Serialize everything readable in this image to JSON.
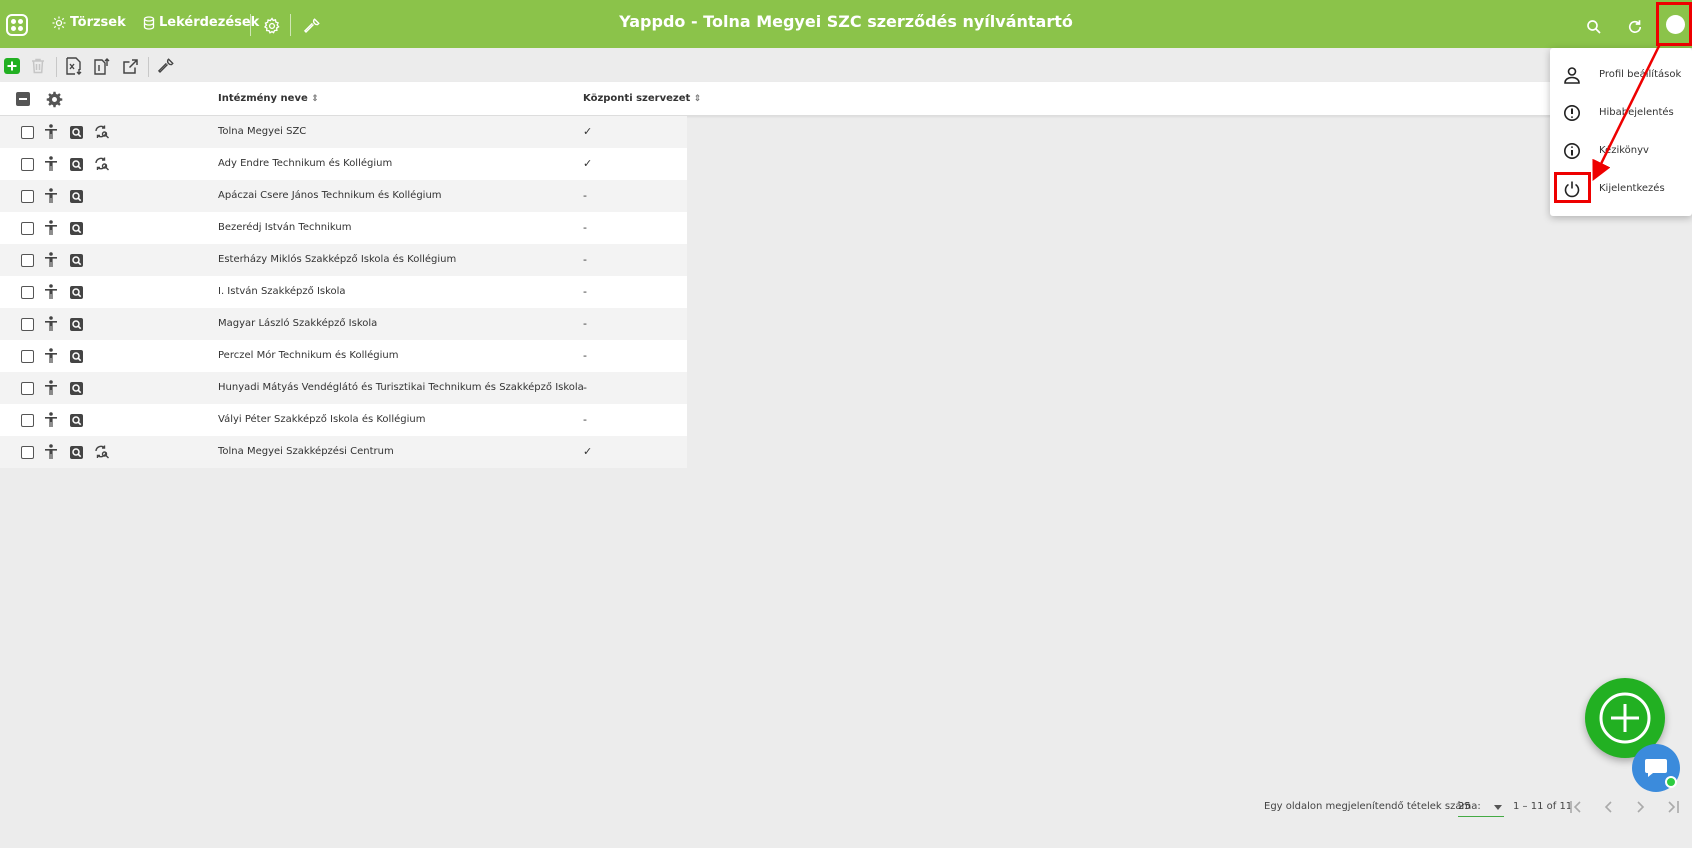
{
  "header": {
    "title": "Yappdo - Tolna Megyei SZC szerződés nyílvántartó",
    "nav": [
      {
        "label": "Törzsek",
        "icon": "sun-icon"
      },
      {
        "label": "Lekérdezések",
        "icon": "database-icon"
      }
    ]
  },
  "table": {
    "columns": {
      "name": "Intézmény neve",
      "central": "Központi szervezet"
    },
    "rows": [
      {
        "name": "Tolna Megyei SZC",
        "central": "✓"
      },
      {
        "name": "Ady Endre Technikum és Kollégium",
        "central": "✓"
      },
      {
        "name": "Apáczai Csere János Technikum és Kollégium",
        "central": "-"
      },
      {
        "name": "Bezerédj István Technikum",
        "central": "-"
      },
      {
        "name": "Esterházy Miklós Szakképző Iskola és Kollégium",
        "central": "-"
      },
      {
        "name": "I. István Szakképző Iskola",
        "central": "-"
      },
      {
        "name": "Magyar László Szakképző Iskola",
        "central": "-"
      },
      {
        "name": "Perczel Mór Technikum és Kollégium",
        "central": "-"
      },
      {
        "name": "Hunyadi Mátyás Vendéglátó és Turisztikai Technikum és Szakképző Iskola",
        "central": "-"
      },
      {
        "name": "Vályi Péter Szakképző Iskola és Kollégium",
        "central": "-"
      },
      {
        "name": "Tolna Megyei Szakképzési Centrum",
        "central": "✓"
      }
    ]
  },
  "user_menu": {
    "items": [
      {
        "label": "Profil beállítások",
        "icon": "person-icon"
      },
      {
        "label": "Hibabejelentés",
        "icon": "alert-icon"
      },
      {
        "label": "Kézikönyv",
        "icon": "info-icon"
      },
      {
        "label": "Kijelentkezés",
        "icon": "power-icon"
      }
    ]
  },
  "pagination": {
    "page_size_label": "Egy oldalon megjelenítendő tételek száma:",
    "page_size": "25",
    "range": "1 – 11 of 11"
  },
  "colors": {
    "header_bg": "#8bc34a",
    "fab": "#22b022",
    "highlight": "#ee0000",
    "chat": "#3b8bdc"
  }
}
